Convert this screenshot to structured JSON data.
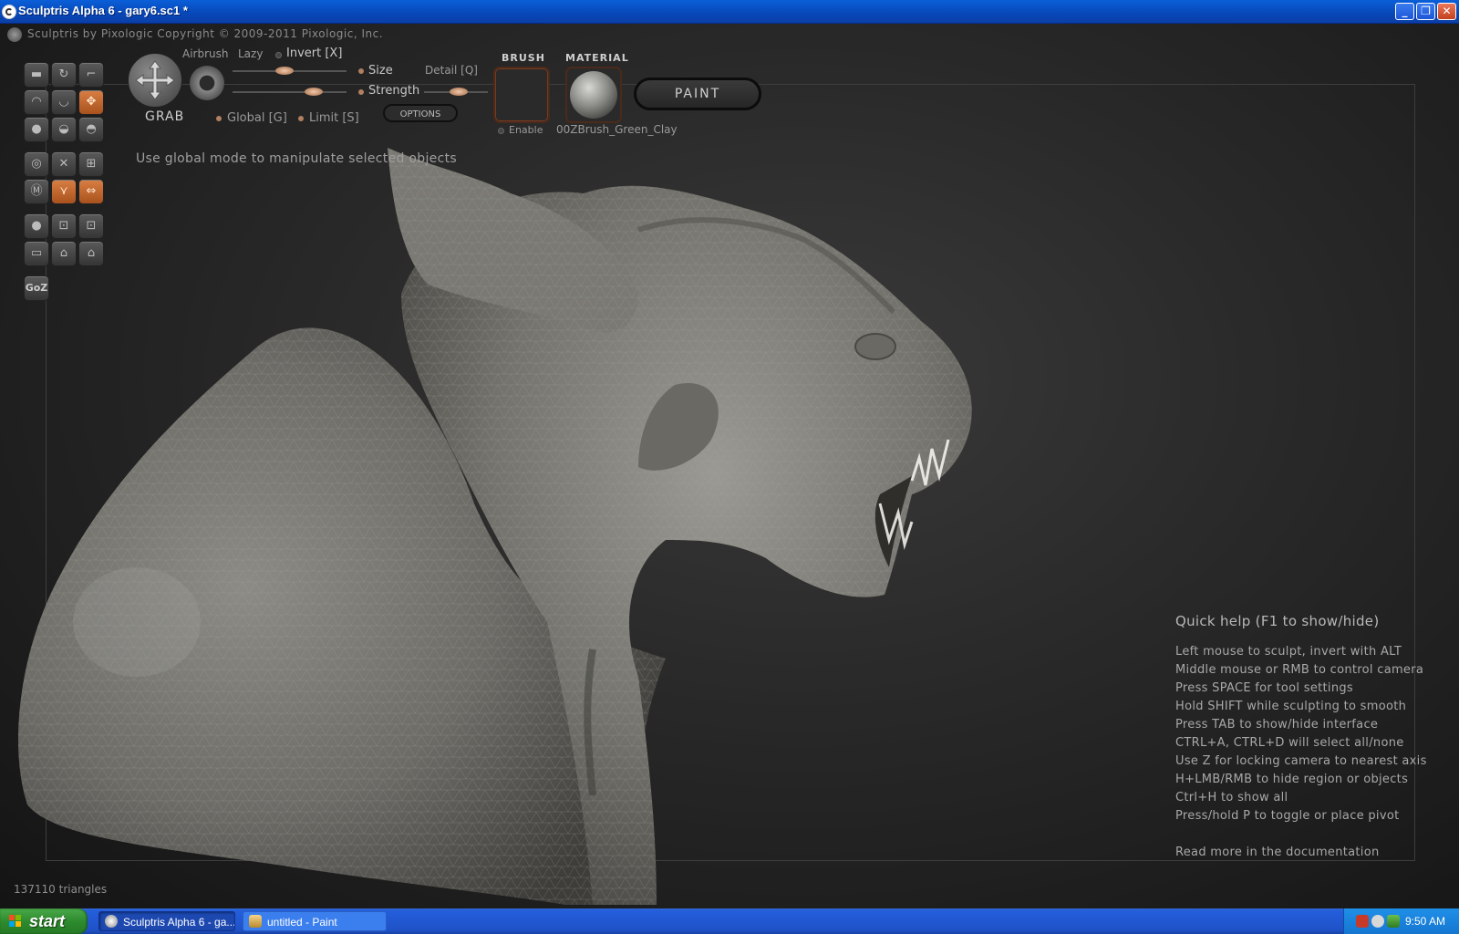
{
  "window": {
    "title": "Sculptris Alpha 6 - gary6.sc1 *",
    "minimize_icon": "minimize-icon",
    "maximize_icon": "restore-icon",
    "close_icon": "close-icon",
    "min_glyph": "_",
    "max_glyph": "❐",
    "close_glyph": "✕"
  },
  "app": {
    "credits": "Sculptris by Pixologic    Copyright © 2009-2011 Pixologic, Inc.",
    "hint": "Use global mode to manipulate selected objects",
    "triangles": "137110 triangles"
  },
  "toolbar": {
    "tool_name": "GRAB",
    "airbrush": "Airbrush",
    "lazy": "Lazy",
    "invert": "Invert [X]",
    "size": "Size",
    "strength": "Strength",
    "detail": "Detail [Q]",
    "global": "Global [G]",
    "limit": "Limit [S]",
    "options": "OPTIONS",
    "size_value": 0.45,
    "strength_value": 0.75,
    "detail_value": 0.55
  },
  "brush": {
    "label": "BRUSH",
    "enable": "Enable"
  },
  "material": {
    "label": "MATERIAL",
    "name": "00ZBrush_Green_Clay"
  },
  "paint_button": "PAINT",
  "goz": "GoZ",
  "quickhelp": {
    "title": "Quick help (F1 to show/hide)",
    "lines": [
      "Left mouse to sculpt, invert with ALT",
      "Middle mouse or RMB to control camera",
      "Press SPACE for tool settings",
      "Hold SHIFT while sculpting to smooth",
      "Press TAB to show/hide interface",
      "CTRL+A, CTRL+D will select all/none",
      "Use Z for locking camera to nearest axis",
      "H+LMB/RMB to hide region or objects",
      "Ctrl+H to show all",
      "Press/hold P to toggle or place pivot"
    ],
    "more": "Read more in the documentation"
  },
  "taskbar": {
    "start": "start",
    "tasks": [
      {
        "label": "Sculptris Alpha 6 - ga...",
        "icon": "sculptris-icon"
      },
      {
        "label": "untitled - Paint",
        "icon": "paint-icon"
      }
    ],
    "clock": "9:50 AM"
  },
  "colors": {
    "accent_orange": "#d97f44",
    "titlebar_blue": "#0847b8",
    "taskbar_blue": "#245edb",
    "start_green": "#2e8b2e"
  }
}
